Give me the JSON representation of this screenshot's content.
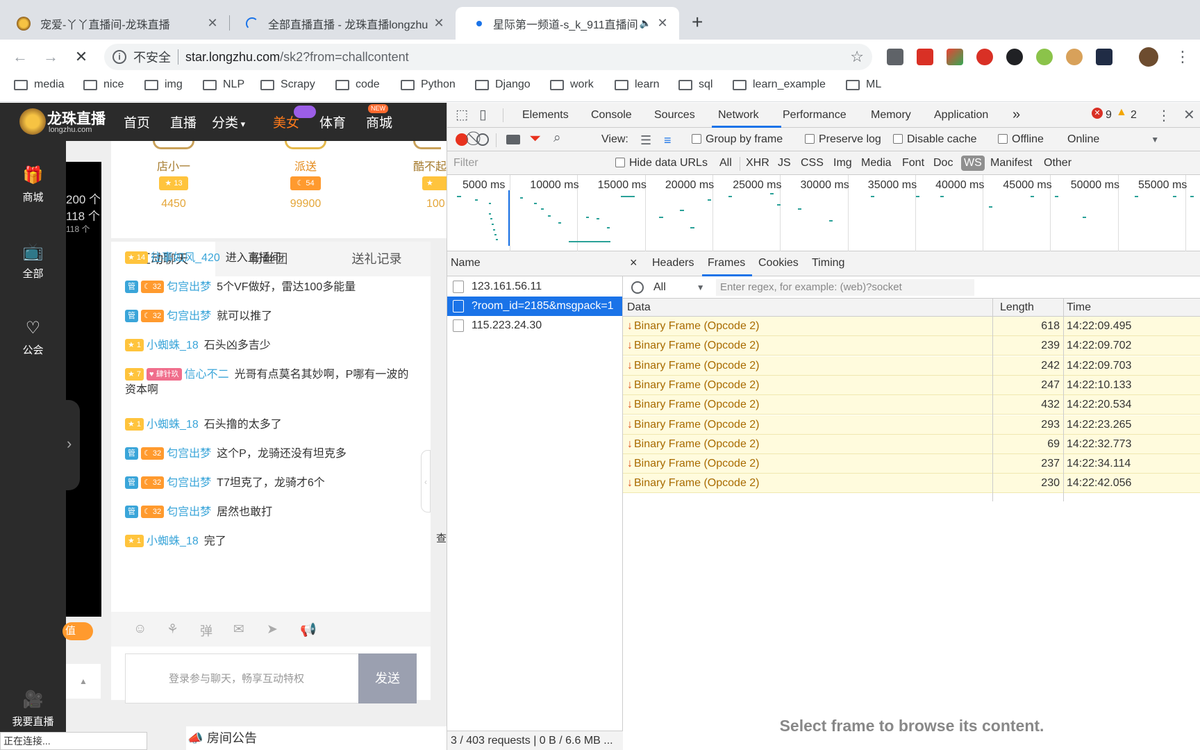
{
  "tabs": [
    {
      "title": "宠爱-丫丫直播间-龙珠直播",
      "active": false
    },
    {
      "title": "全部直播直播 - 龙珠直播longzhu",
      "active": false
    },
    {
      "title": "星际第一频道-s_k_911直播间",
      "active": true
    }
  ],
  "new_tab": "+",
  "omnibox": {
    "security": "不安全",
    "host": "star.longzhu.com",
    "path": "/sk2?from=challcontent"
  },
  "bookmarks": [
    "media",
    "nice",
    "img",
    "NLP",
    "Scrapy",
    "code",
    "Python",
    "Django",
    "work",
    "learn",
    "sql",
    "learn_example",
    "ML"
  ],
  "site": {
    "logo": "龙珠直播",
    "logo_sub": "longzhu.com",
    "nav": [
      "首页",
      "直播",
      "分类",
      "美女",
      "体育",
      "商城"
    ],
    "nav_new_badge": "NEW",
    "rail": [
      "商城",
      "全部",
      "公会",
      "我要直播"
    ],
    "video_overlay": [
      "200 个",
      "118 个",
      "118 个"
    ],
    "hosts": [
      {
        "name": "店小一",
        "badge": "13",
        "count": "4450"
      },
      {
        "name": "派送",
        "badge": "54",
        "count": "99900"
      },
      {
        "name": "酷不起",
        "badge": "",
        "count": "100"
      }
    ],
    "chat_tabs": [
      "互动聊天",
      "粉丝团",
      "送礼记录"
    ],
    "messages": [
      {
        "badges": [
          {
            "type": "star",
            "text": "14"
          }
        ],
        "user": "往事如风_420",
        "text": "进入直播间"
      },
      {
        "badges": [
          {
            "type": "mgr",
            "text": "管"
          },
          {
            "type": "moon",
            "text": "32"
          }
        ],
        "user": "匂宫出梦",
        "text": "5个VF做好，雷达100多能量"
      },
      {
        "badges": [
          {
            "type": "mgr",
            "text": "管"
          },
          {
            "type": "moon",
            "text": "32"
          }
        ],
        "user": "匂宫出梦",
        "text": "就可以推了"
      },
      {
        "badges": [
          {
            "type": "star",
            "text": "1"
          }
        ],
        "user": "小蜘蛛_18",
        "text": "石头凶多吉少"
      },
      {
        "badges": [
          {
            "type": "star",
            "text": "7"
          },
          {
            "type": "fan",
            "text": "肆针玖"
          }
        ],
        "user": "信心不二",
        "text": "光哥有点莫名其妙啊，P哪有一波的资本啊"
      },
      {
        "badges": [
          {
            "type": "star",
            "text": "1"
          }
        ],
        "user": "小蜘蛛_18",
        "text": "石头撸的太多了"
      },
      {
        "badges": [
          {
            "type": "mgr",
            "text": "管"
          },
          {
            "type": "moon",
            "text": "32"
          }
        ],
        "user": "匂宫出梦",
        "text": "这个P，龙骑还没有坦克多"
      },
      {
        "badges": [
          {
            "type": "mgr",
            "text": "管"
          },
          {
            "type": "moon",
            "text": "32"
          }
        ],
        "user": "匂宫出梦",
        "text": "T7坦克了，龙骑才6个"
      },
      {
        "badges": [
          {
            "type": "mgr",
            "text": "管"
          },
          {
            "type": "moon",
            "text": "32"
          }
        ],
        "user": "匂宫出梦",
        "text": "居然也敢打"
      },
      {
        "badges": [
          {
            "type": "star",
            "text": "1"
          }
        ],
        "user": "小蜘蛛_18",
        "text": "完了"
      }
    ],
    "tool_dan": "弹",
    "side_char": "查",
    "orange_pill": "值",
    "chat_placeholder": "登录参与聊天，畅享互动特权",
    "send_label": "发送",
    "announcement": "房间公告",
    "status_text": "正在连接..."
  },
  "devtools": {
    "tabs": [
      "Elements",
      "Console",
      "Sources",
      "Network",
      "Performance",
      "Memory",
      "Application"
    ],
    "more": "»",
    "active_tab": "Network",
    "errors": "9",
    "warnings": "2",
    "view_label": "View:",
    "group_by_frame": "Group by frame",
    "preserve_log": "Preserve log",
    "disable_cache": "Disable cache",
    "offline": "Offline",
    "throttle": "Online",
    "filter_placeholder": "Filter",
    "hide_data_urls": "Hide data URLs",
    "types": [
      "All",
      "XHR",
      "JS",
      "CSS",
      "Img",
      "Media",
      "Font",
      "Doc",
      "WS",
      "Manifest",
      "Other"
    ],
    "active_type": "WS",
    "timeline_ticks": [
      "5000 ms",
      "10000 ms",
      "15000 ms",
      "20000 ms",
      "25000 ms",
      "30000 ms",
      "35000 ms",
      "40000 ms",
      "45000 ms",
      "50000 ms",
      "55000 ms"
    ],
    "name_header": "Name",
    "requests": [
      {
        "name": "123.161.56.11",
        "selected": false
      },
      {
        "name": "?room_id=2185&msgpack=1",
        "selected": true
      },
      {
        "name": "115.223.24.30",
        "selected": false
      }
    ],
    "summary": "3 / 403 requests | 0 B / 6.6 MB ...",
    "detail_close": "×",
    "detail_tabs": [
      "Headers",
      "Frames",
      "Cookies",
      "Timing"
    ],
    "active_detail_tab": "Frames",
    "frame_filter_value": "All",
    "frame_filter_placeholder": "Enter regex, for example: (web)?socket",
    "frame_columns": [
      "Data",
      "Length",
      "Time"
    ],
    "frames": [
      {
        "data": "Binary Frame (Opcode 2)",
        "length": "618",
        "time": "14:22:09.495"
      },
      {
        "data": "Binary Frame (Opcode 2)",
        "length": "239",
        "time": "14:22:09.702"
      },
      {
        "data": "Binary Frame (Opcode 2)",
        "length": "242",
        "time": "14:22:09.703"
      },
      {
        "data": "Binary Frame (Opcode 2)",
        "length": "247",
        "time": "14:22:10.133"
      },
      {
        "data": "Binary Frame (Opcode 2)",
        "length": "432",
        "time": "14:22:20.534"
      },
      {
        "data": "Binary Frame (Opcode 2)",
        "length": "293",
        "time": "14:22:23.265"
      },
      {
        "data": "Binary Frame (Opcode 2)",
        "length": "69",
        "time": "14:22:32.773"
      },
      {
        "data": "Binary Frame (Opcode 2)",
        "length": "237",
        "time": "14:22:34.114"
      },
      {
        "data": "Binary Frame (Opcode 2)",
        "length": "230",
        "time": "14:22:42.056"
      }
    ],
    "placeholder": "Select frame to browse its content."
  },
  "colors": {
    "accent": "#1a73e8",
    "record": "#e8321e",
    "frame_bg": "#fffbdd",
    "frame_text": "#a86b00",
    "chat_user": "#3aa5d9"
  }
}
